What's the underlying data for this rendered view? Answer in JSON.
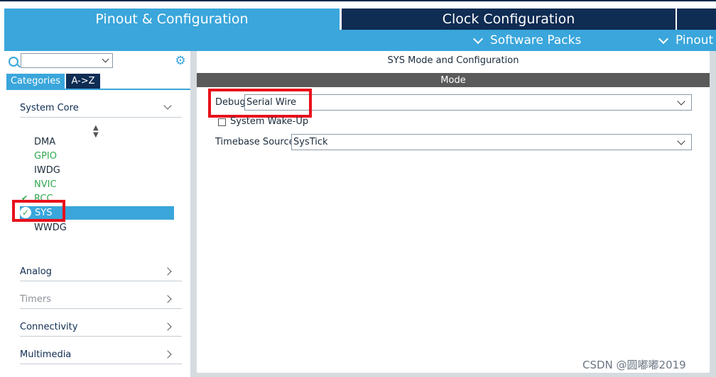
{
  "tabs": {
    "pinout": "Pinout & Configuration",
    "clock": "Clock Configuration"
  },
  "toolbar": {
    "software_packs": "Software Packs",
    "pinout": "Pinout"
  },
  "left_panel": {
    "search_value": "",
    "tab_categories": "Categories",
    "tab_az": "A->Z",
    "categories": [
      {
        "label": "System Core",
        "expanded": true
      },
      {
        "label": "Analog",
        "expanded": false
      },
      {
        "label": "Timers",
        "expanded": false,
        "disabled": true
      },
      {
        "label": "Connectivity",
        "expanded": false
      },
      {
        "label": "Multimedia",
        "expanded": false
      }
    ],
    "system_core_items": [
      "DMA",
      "GPIO",
      "IWDG",
      "NVIC",
      "RCC",
      "SYS",
      "WWDG"
    ],
    "selected_item": "SYS"
  },
  "right_panel": {
    "title": "SYS Mode and Configuration",
    "mode_header": "Mode",
    "debug_label": "Debug",
    "debug_value": "Serial Wire",
    "wakeup_label": "System Wake-Up",
    "wakeup_checked": false,
    "timebase_label": "Timebase Source",
    "timebase_value": "SysTick"
  },
  "watermark": "CSDN @圆嘟嘟2019",
  "colors": {
    "accent": "#3aa6db",
    "navy": "#0f2c53",
    "highlight_red": "#e8101c",
    "ok_green": "#2fa84f",
    "mode_bar": "#5a5a5a"
  }
}
